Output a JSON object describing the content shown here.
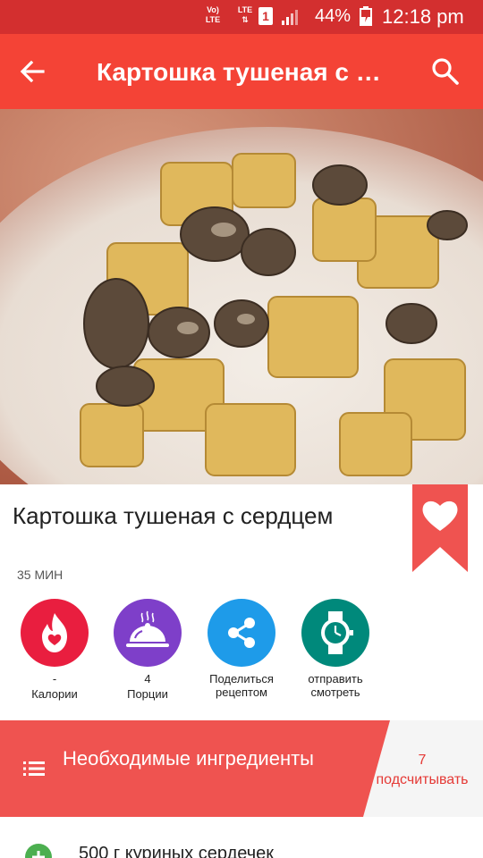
{
  "status_bar": {
    "volte": "Vo) LTE",
    "lte": "LTE",
    "sim": "1",
    "battery": "44%",
    "time": "12:18 pm"
  },
  "app_bar": {
    "title": "Картошка тушеная с сердцем",
    "back_icon": "arrow-back-icon",
    "search_icon": "search-icon"
  },
  "hero": {
    "icon": "recipe-photo"
  },
  "recipe": {
    "title": "Картошка тушеная с сердцем",
    "time": "35 МИН",
    "favorite_icon": "heart-icon"
  },
  "actions": [
    {
      "value": "-",
      "label": "Калории",
      "icon": "flame-heart-icon",
      "color": "#e91e3f"
    },
    {
      "value": "4",
      "label": "Порции",
      "icon": "serving-dish-icon",
      "color": "#7e3fc9"
    },
    {
      "value": "Поделиться",
      "label": "рецептом",
      "icon": "share-icon",
      "color": "#1e9be9"
    },
    {
      "value": "отправить",
      "label": "смотреть",
      "icon": "watch-icon",
      "color": "#00897b"
    }
  ],
  "ingredients": {
    "title": "Необходимые ингредиенты",
    "count": "7",
    "count_label": "подсчитывать",
    "items": [
      {
        "text": "500 г куриных сердечек"
      }
    ]
  },
  "colors": {
    "status_bar": "#d32f2f",
    "app_bar": "#f44336",
    "accent": "#ef5350"
  }
}
